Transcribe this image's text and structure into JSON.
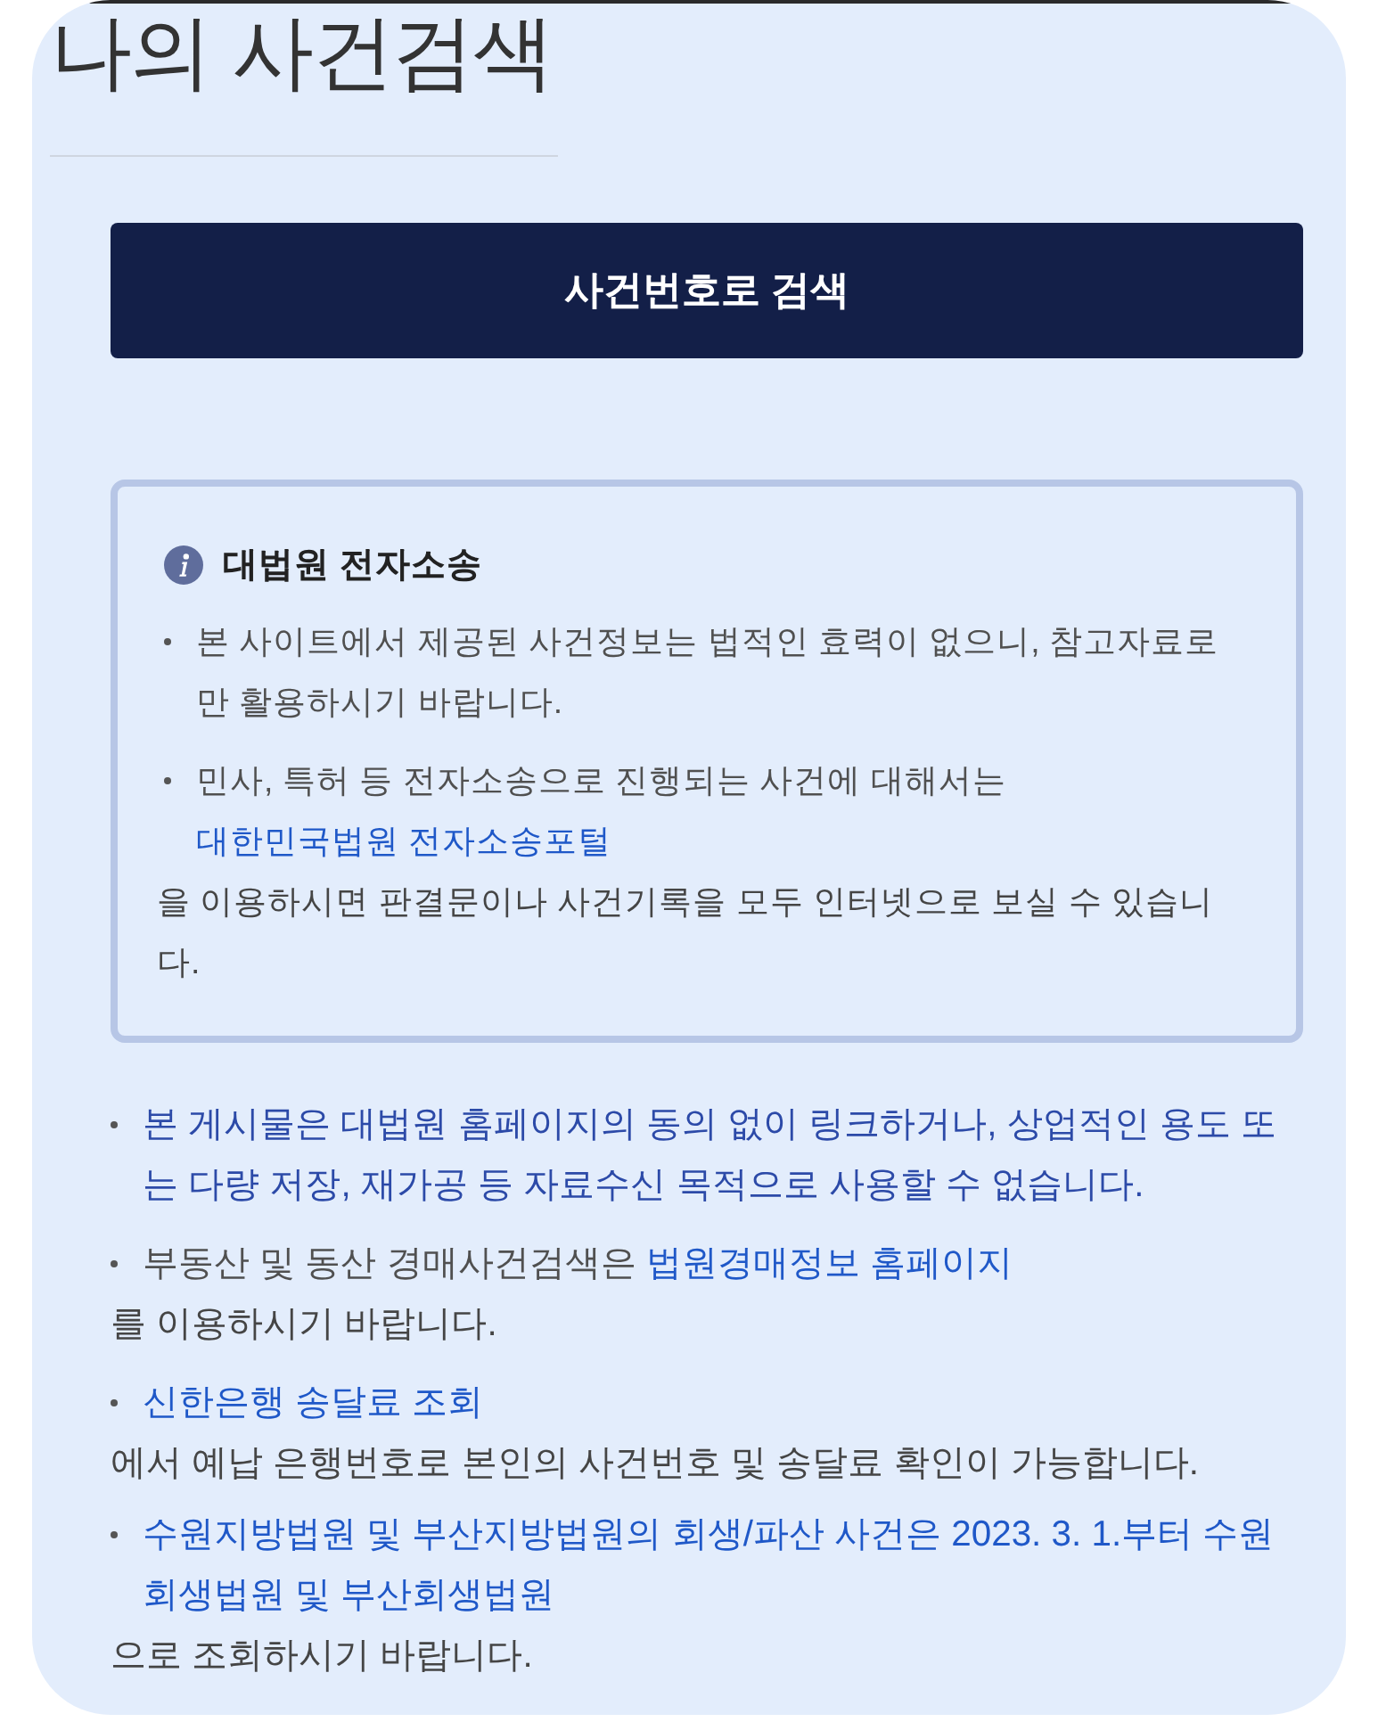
{
  "page": {
    "title": "나의 사건검색"
  },
  "search_button": {
    "label": "사건번호로 검색"
  },
  "info_box": {
    "heading": "대법원 전자소송",
    "items": [
      {
        "text": "본 사이트에서 제공된 사건정보는 법적인 효력이 없으니, 참고자료로만 활용하시기 바랍니다."
      },
      {
        "text": "민사, 특허 등 전자소송으로 진행되는 사건에 대해서는",
        "link": "대한민국법원 전자소송포털",
        "after": "을 이용하시면 판결문이나 사건기록을 모두 인터넷으로 보실 수 있습니다."
      }
    ]
  },
  "notices": [
    {
      "kind": "emphasis",
      "text": "본 게시물은 대법원 홈페이지의 동의 없이 링크하거나, 상업적인 용도 또는 다량 저장, 재가공 등 자료수신 목적으로 사용할 수 없습니다."
    },
    {
      "kind": "plain",
      "text": "부동산 및 동산 경매사건검색은",
      "link": "법원경매정보 홈페이지",
      "after": "를 이용하시기 바랍니다."
    },
    {
      "kind": "plain",
      "link": "신한은행 송달료 조회",
      "after": "에서 예납 은행번호로 본인의 사건번호 및 송달료 확인이 가능합니다."
    },
    {
      "kind": "plain",
      "link": "수원지방법원 및 부산지방법원의 회생/파산 사건은 2023. 3. 1.부터 수원회생법원 및 부산회생법원",
      "after": "으로 조회하시기 바랍니다."
    }
  ]
}
